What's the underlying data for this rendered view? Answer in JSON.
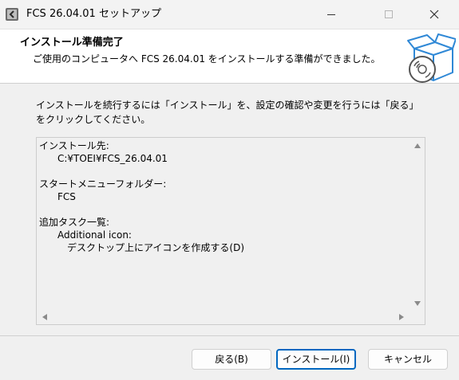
{
  "window": {
    "title": "FCS 26.04.01 セットアップ"
  },
  "header": {
    "title": "インストール準備完了",
    "subtitle": "ご使用のコンピュータへ FCS 26.04.01 をインストールする準備ができました。",
    "image_icon": "box-with-cd-icon"
  },
  "intro": {
    "line1": "インストールを続行するには「インストール」を、設定の確認や変更を行うには「戻る」",
    "line2": "をクリックしてください。"
  },
  "memo": {
    "install_dir_label": "インストール先:",
    "install_dir_value": "C:¥TOEI¥FCS_26.04.01",
    "start_menu_label": "スタートメニューフォルダー:",
    "start_menu_value": "FCS",
    "tasks_label": "追加タスク一覧:",
    "tasks_group": "Additional icon:",
    "tasks_item": "デスクトップ上にアイコンを作成する(D)"
  },
  "buttons": {
    "back": "戻る(B)",
    "install": "インストール(I)",
    "cancel": "キャンセル"
  },
  "colors": {
    "accent": "#0067c0",
    "header_bg": "#ffffff",
    "window_bg": "#f0f0f0",
    "illustration": "#2f88d6"
  }
}
